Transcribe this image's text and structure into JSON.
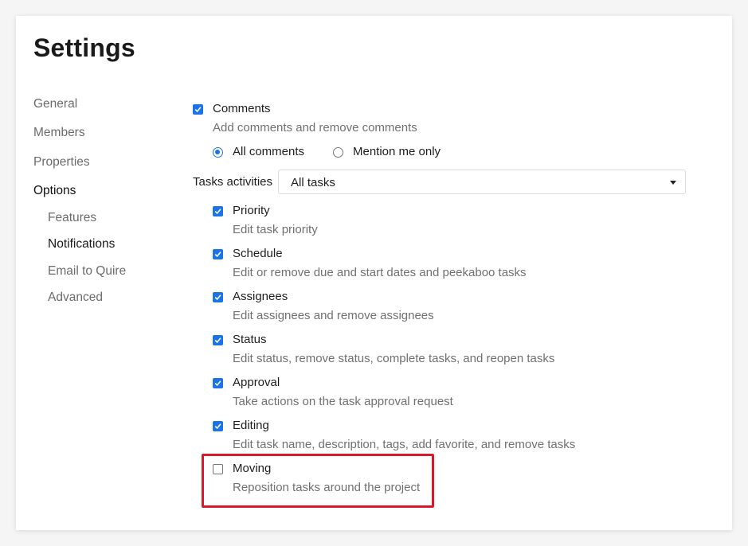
{
  "page": {
    "title": "Settings"
  },
  "nav": {
    "items": [
      {
        "label": "General"
      },
      {
        "label": "Members"
      },
      {
        "label": "Properties"
      },
      {
        "label": "Options"
      }
    ],
    "sub_items": [
      {
        "label": "Features"
      },
      {
        "label": "Notifications"
      },
      {
        "label": "Email to Quire"
      },
      {
        "label": "Advanced"
      }
    ]
  },
  "comments": {
    "label": "Comments",
    "checked": true,
    "description": "Add comments and remove comments",
    "radio_options": [
      {
        "label": "All comments",
        "selected": true
      },
      {
        "label": "Mention me only",
        "selected": false
      }
    ]
  },
  "tasks_activities": {
    "label": "Tasks activities",
    "selected": "All tasks"
  },
  "task_options": [
    {
      "label": "Priority",
      "description": "Edit task priority",
      "checked": true
    },
    {
      "label": "Schedule",
      "description": "Edit or remove due and start dates and peekaboo tasks",
      "checked": true
    },
    {
      "label": "Assignees",
      "description": "Edit assignees and remove assignees",
      "checked": true
    },
    {
      "label": "Status",
      "description": "Edit status, remove status, complete tasks, and reopen tasks",
      "checked": true
    },
    {
      "label": "Approval",
      "description": "Take actions on the task approval request",
      "checked": true
    },
    {
      "label": "Editing",
      "description": "Edit task name, description, tags, add favorite, and remove tasks",
      "checked": true
    },
    {
      "label": "Moving",
      "description": "Reposition tasks around the project",
      "checked": false
    }
  ],
  "colors": {
    "accent": "#1a73e8",
    "highlight": "#d6192b"
  }
}
